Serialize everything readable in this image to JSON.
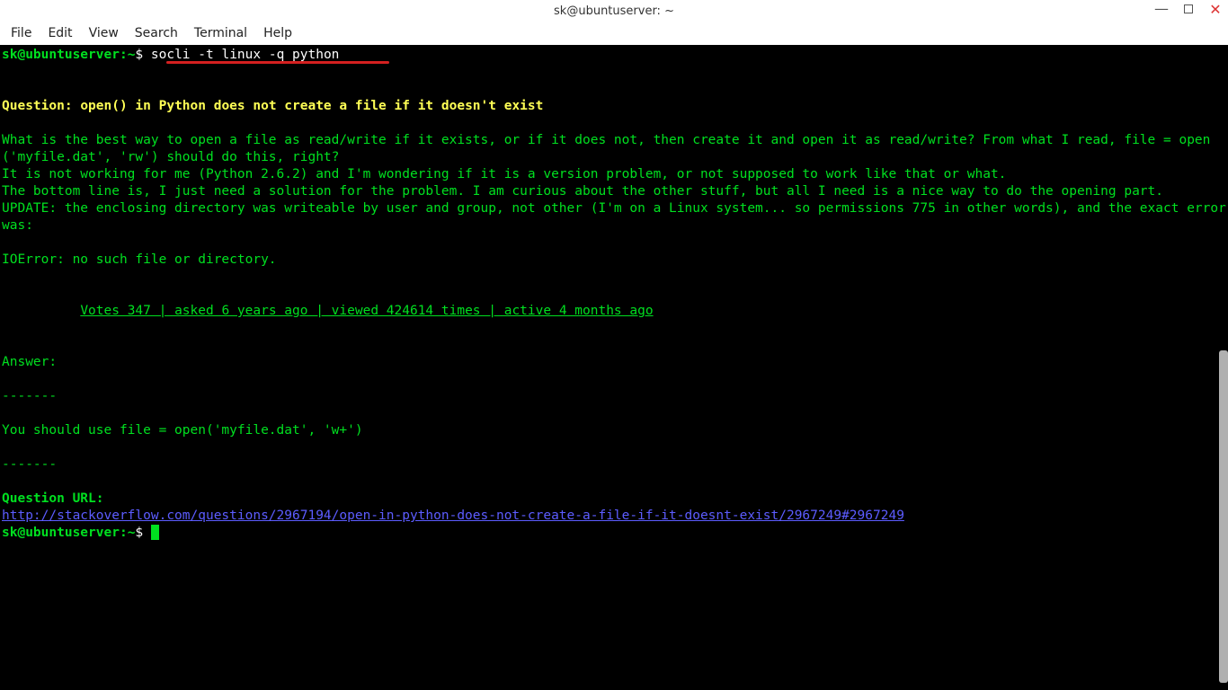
{
  "window": {
    "title": "sk@ubuntuserver: ~"
  },
  "menu": {
    "items": [
      "File",
      "Edit",
      "View",
      "Search",
      "Terminal",
      "Help"
    ]
  },
  "prompt": {
    "user_host": "sk@ubuntuserver",
    "colon": ":",
    "path": "~",
    "symbol": "$"
  },
  "command": "socli -t linux -q python",
  "output": {
    "question_label": "Question: ",
    "question_title": "open() in Python does not create a file if it doesn't exist",
    "body_line1": "What is the best way to open a file as read/write if it exists, or if it does not, then create it and open it as read/write? From what I read, file = open('myfile.dat', 'rw') should do this, right?",
    "body_line2": "It is not working for me (Python 2.6.2) and I'm wondering if it is a version problem, or not supposed to work like that or what.",
    "body_line3": "The bottom line is, I just need a solution for the problem. I am curious about the other stuff, but all I need is a nice way to do the opening part.",
    "body_line4": "UPDATE: the enclosing directory was writeable by user and group, not other (I'm on a Linux system... so permissions 775 in other words), and the exact error was:",
    "body_error": "IOError: no such file or directory.",
    "stats_indent": "          ",
    "stats": "Votes 347 | asked 6 years ago | viewed 424614 times | active 4 months ago",
    "answer_label": "Answer:",
    "separator": "-------",
    "answer_body": "You should use file = open('myfile.dat', 'w+')",
    "question_url_label": "Question URL:",
    "question_url": "http://stackoverflow.com/questions/2967194/open-in-python-does-not-create-a-file-if-it-doesnt-exist/2967249#2967249"
  }
}
